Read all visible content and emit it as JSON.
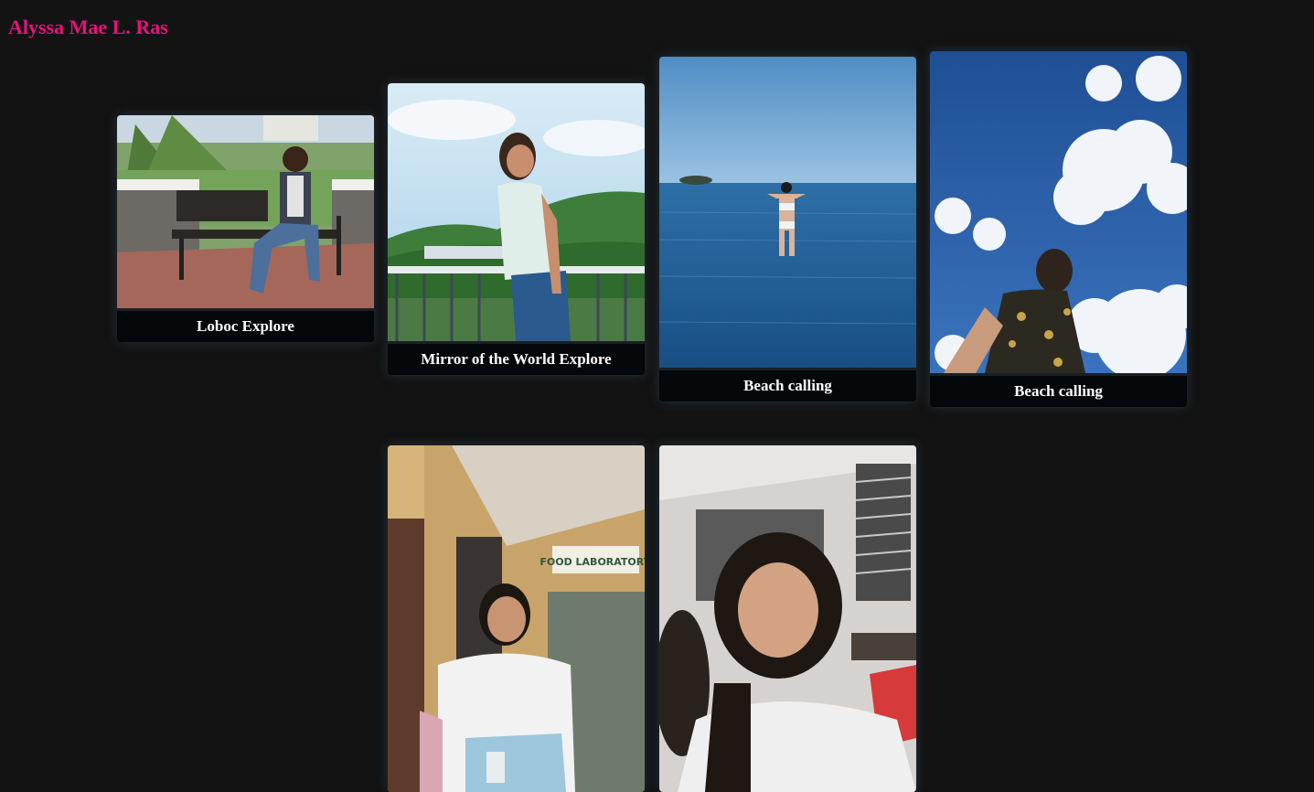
{
  "site": {
    "title": "Alyssa Mae L. Ras",
    "title_color": "#e8127a",
    "background": "#131313"
  },
  "gallery": {
    "cards": [
      {
        "caption": "Loboc Explore",
        "photo": "woman-on-bench-garden-photo"
      },
      {
        "caption": "Mirror of the World Explore",
        "photo": "woman-at-railing-hills-photo"
      },
      {
        "caption": "Beach calling",
        "photo": "woman-in-sea-photo"
      },
      {
        "caption": "Beach calling",
        "photo": "woman-under-cloudy-sky-photo"
      },
      {
        "caption": "",
        "photo": "food-laboratory-portrait-photo"
      },
      {
        "caption": "",
        "photo": "classroom-selfie-photo"
      }
    ]
  }
}
